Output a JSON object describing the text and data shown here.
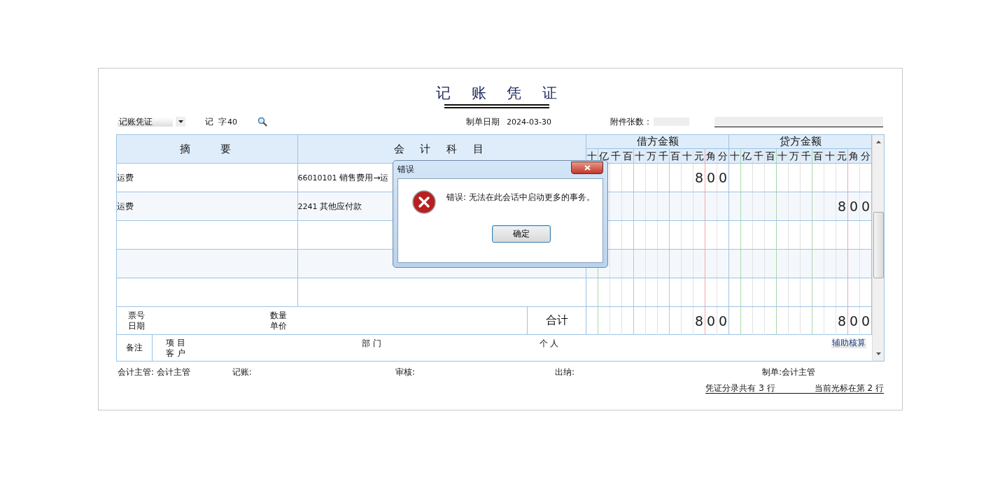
{
  "title": "记 账 凭 证",
  "toolbar": {
    "voucher_type": "记账凭证",
    "voucher_word": "记",
    "voucher_char": "字",
    "voucher_number": "40",
    "date_label": "制单日期",
    "date": "2024-03-30",
    "attachments_label": "附件张数："
  },
  "table": {
    "columns": [
      {
        "label": "摘　　要"
      },
      {
        "label": "会 计 科 目"
      }
    ],
    "money_columns": [
      {
        "label": "借方金额",
        "digits": [
          "十",
          "亿",
          "千",
          "百",
          "十",
          "万",
          "千",
          "百",
          "十",
          "元",
          "角",
          "分"
        ]
      },
      {
        "label": "贷方金额",
        "digits": [
          "十",
          "亿",
          "千",
          "百",
          "十",
          "万",
          "千",
          "百",
          "十",
          "元",
          "角",
          "分"
        ]
      }
    ],
    "rows": [
      {
        "summary": "运费",
        "account_code": "66010101",
        "account": "销售费用→运",
        "debit": "800"
      },
      {
        "summary": "运费",
        "account_code": "2241",
        "account": "其他应付款",
        "credit": "800"
      },
      {},
      {},
      {}
    ],
    "totals": {
      "ticket_label": "票号",
      "date_label": "日期",
      "quantity_label": "数量",
      "price_label": "单价",
      "total_label": "合计",
      "debit": "800",
      "credit": "800"
    },
    "remarks": {
      "label": "备注",
      "project_label": "项 目",
      "customer_label": "客 户",
      "department_label": "部 门",
      "person_label": "个 人",
      "aux_button": "辅助核算"
    }
  },
  "signatures": [
    {
      "text": "会计主管: 会计主管"
    },
    {
      "text": "记账:"
    },
    {
      "text": "审核:"
    },
    {
      "text": "出纳:"
    },
    {
      "text": "制单:会计主管"
    }
  ],
  "status": {
    "entries": "凭证分录共有 3 行",
    "cursor": "当前光标在第 2 行"
  },
  "dialog": {
    "title": "错误",
    "message": "错误: 无法在此会话中启动更多的事务。",
    "button": "确定"
  }
}
